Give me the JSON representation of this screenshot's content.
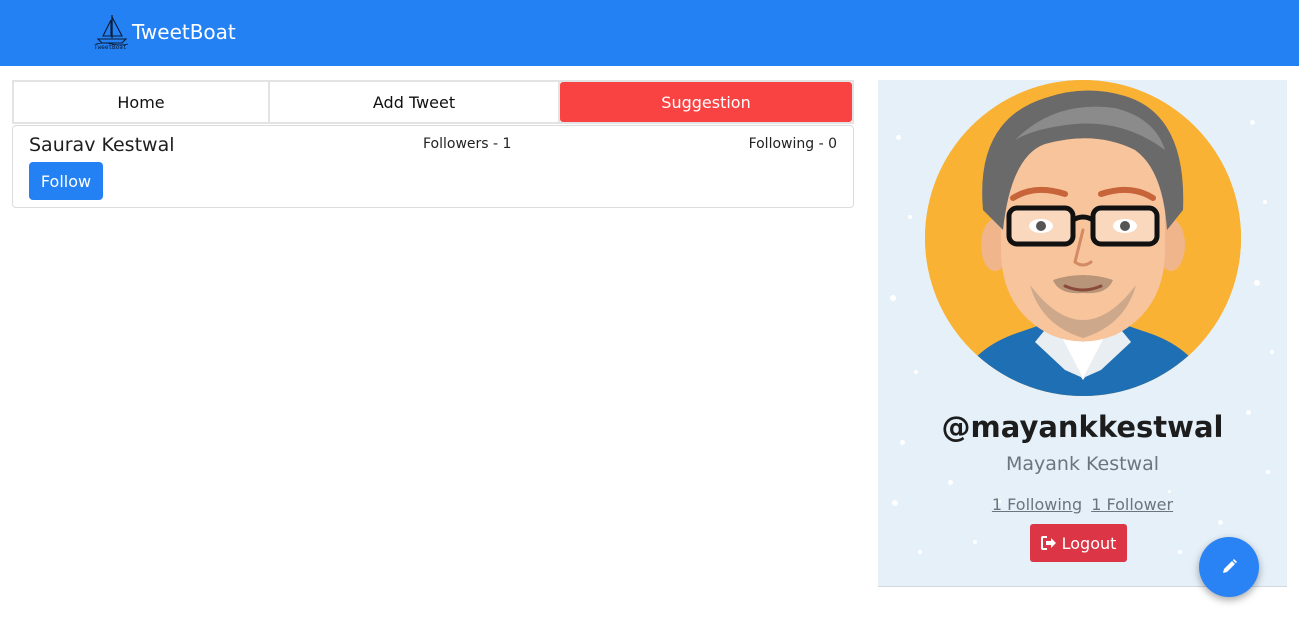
{
  "navbar": {
    "brand_name": "TweetBoat",
    "logo_text": "TweetBoat",
    "logo_icon": "sailboat-icon",
    "color": "#2481f4"
  },
  "tabs": [
    {
      "label": "Home",
      "active": false
    },
    {
      "label": "Add Tweet",
      "active": false
    },
    {
      "label": "Suggestion",
      "active": true
    }
  ],
  "suggestions": [
    {
      "name": "Saurav Kestwal",
      "followers": "Followers - 1",
      "following": "Following - 0",
      "follow_label": "Follow"
    }
  ],
  "profile": {
    "avatar_icon": "avatar-illustration",
    "handle": "@mayankkestwal",
    "full_name": "Mayank Kestwal",
    "following_link": "1 Following",
    "follower_link": "1 Follower",
    "logout_label": "Logout",
    "logout_icon": "sign-out-icon"
  },
  "fab": {
    "icon": "pencil-icon"
  },
  "colors": {
    "primary": "#2481f4",
    "active_tab": "#f94343",
    "danger": "#dc3545",
    "panel_bg": "#e5f0f9",
    "avatar_bg": "#f9b233"
  }
}
